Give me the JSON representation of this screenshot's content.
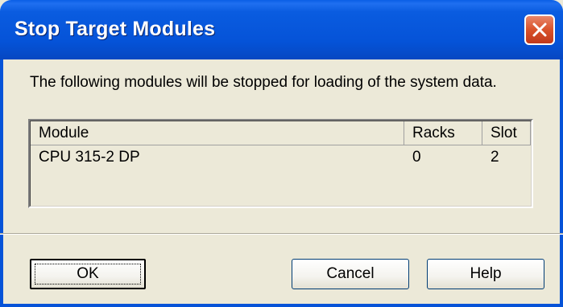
{
  "window": {
    "title": "Stop Target Modules",
    "close_icon": "close-icon"
  },
  "message": "The following modules will be stopped for loading of the system data.",
  "table": {
    "columns": [
      "Module",
      "Racks",
      "Slot"
    ],
    "rows": [
      {
        "module": "CPU 315-2 DP",
        "racks": "0",
        "slot": "2"
      }
    ]
  },
  "buttons": {
    "ok": "OK",
    "cancel": "Cancel",
    "help": "Help"
  },
  "colors": {
    "titlebar": "#0553d8",
    "close_button": "#d9522a",
    "dialog_background": "#ece9d8"
  }
}
